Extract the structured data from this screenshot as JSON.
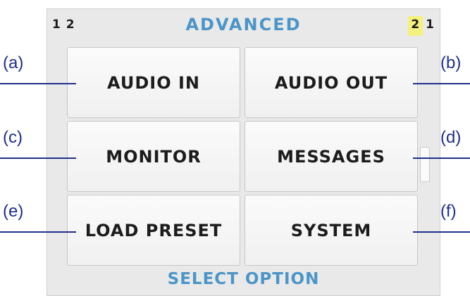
{
  "header": {
    "left": "1 2",
    "title": "ADVANCED",
    "right_highlight": "2",
    "right": "1"
  },
  "buttons": [
    {
      "label": "AUDIO IN",
      "callout": "(a)"
    },
    {
      "label": "AUDIO OUT",
      "callout": "(b)"
    },
    {
      "label": "MONITOR",
      "callout": "(c)"
    },
    {
      "label": "MESSAGES",
      "callout": "(d)"
    },
    {
      "label": "LOAD PRESET",
      "callout": "(e)"
    },
    {
      "label": "SYSTEM",
      "callout": "(f)"
    }
  ],
  "footer": {
    "text": "SELECT OPTION"
  },
  "colors": {
    "title": "#4b95c7",
    "callout": "#1f2f8a",
    "highlight": "#f4f17c"
  }
}
